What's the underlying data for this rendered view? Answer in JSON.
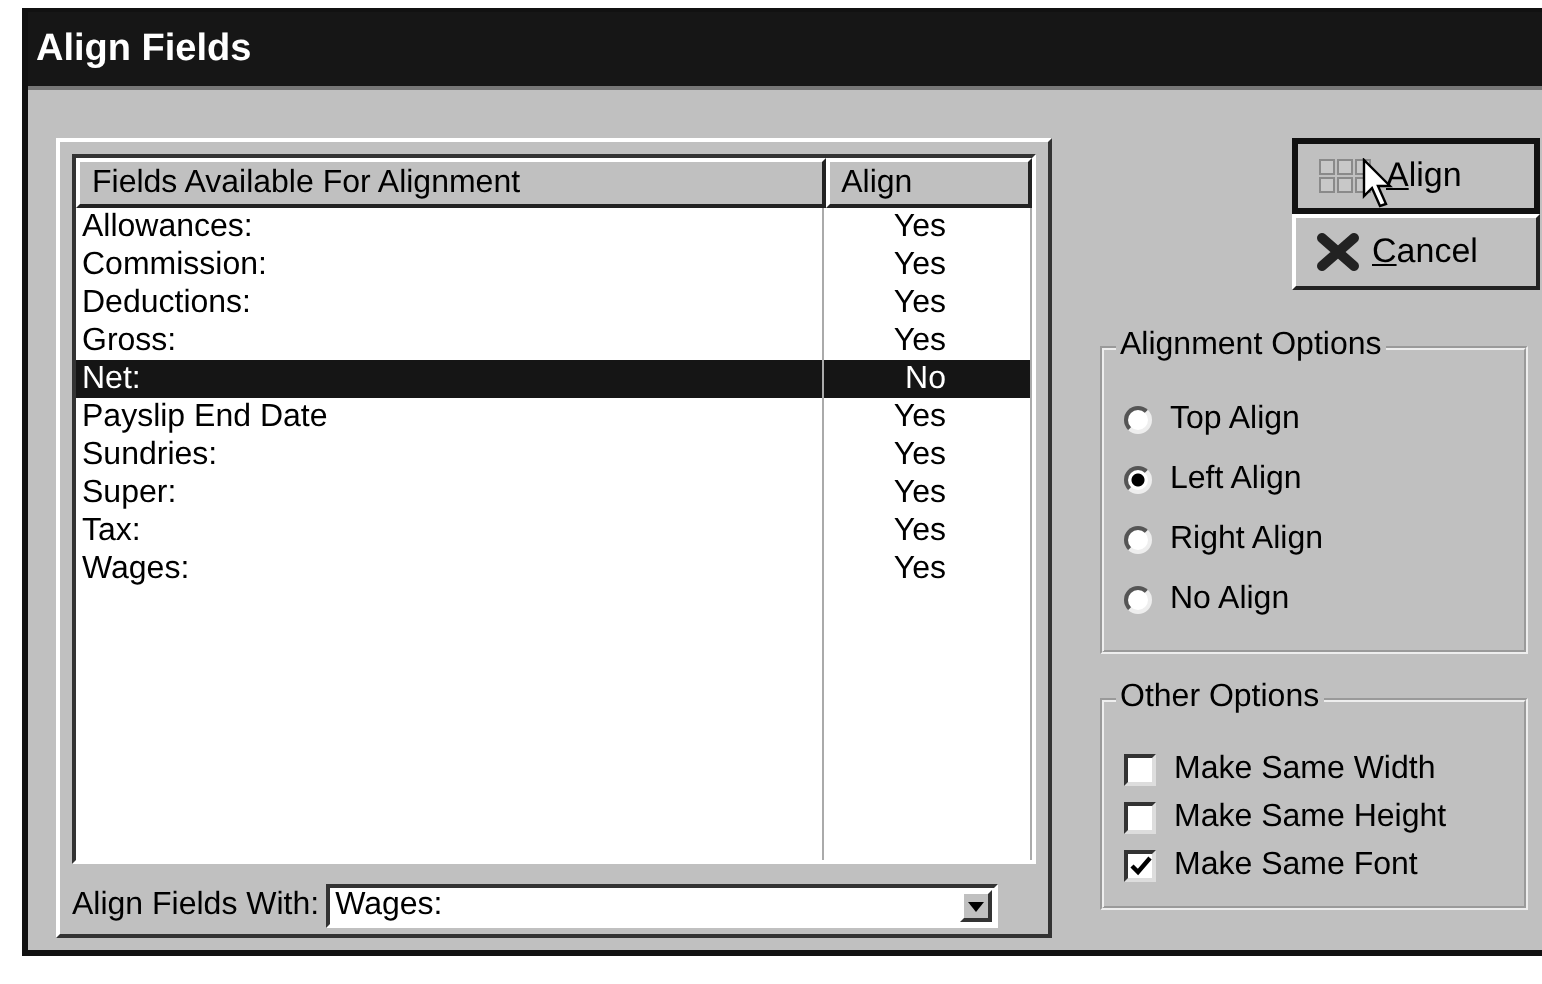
{
  "window": {
    "title": "Align Fields"
  },
  "list": {
    "columns": [
      "Fields Available For Alignment",
      "Align"
    ],
    "rows": [
      {
        "name": "Allowances:",
        "align": "Yes",
        "selected": false
      },
      {
        "name": "Commission:",
        "align": "Yes",
        "selected": false
      },
      {
        "name": "Deductions:",
        "align": "Yes",
        "selected": false
      },
      {
        "name": "Gross:",
        "align": "Yes",
        "selected": false
      },
      {
        "name": "Net:",
        "align": "No",
        "selected": true
      },
      {
        "name": "Payslip End Date",
        "align": "Yes",
        "selected": false
      },
      {
        "name": "Sundries:",
        "align": "Yes",
        "selected": false
      },
      {
        "name": "Super:",
        "align": "Yes",
        "selected": false
      },
      {
        "name": "Tax:",
        "align": "Yes",
        "selected": false
      },
      {
        "name": "Wages:",
        "align": "Yes",
        "selected": false
      }
    ]
  },
  "align_with": {
    "label": "Align Fields With:",
    "value": "Wages:"
  },
  "buttons": [
    {
      "label": "Align",
      "kind": "align"
    },
    {
      "label": "Cancel",
      "kind": "cancel"
    }
  ],
  "alignment_options": {
    "title": "Alignment Options",
    "options": [
      {
        "label": "Top Align",
        "selected": false
      },
      {
        "label": "Left Align",
        "selected": true
      },
      {
        "label": "Right Align",
        "selected": false
      },
      {
        "label": "No Align",
        "selected": false
      }
    ]
  },
  "other_options": {
    "title": "Other Options",
    "options": [
      {
        "label": "Make Same Width",
        "checked": false
      },
      {
        "label": "Make Same Height",
        "checked": false
      },
      {
        "label": "Make Same Font",
        "checked": true
      }
    ]
  }
}
